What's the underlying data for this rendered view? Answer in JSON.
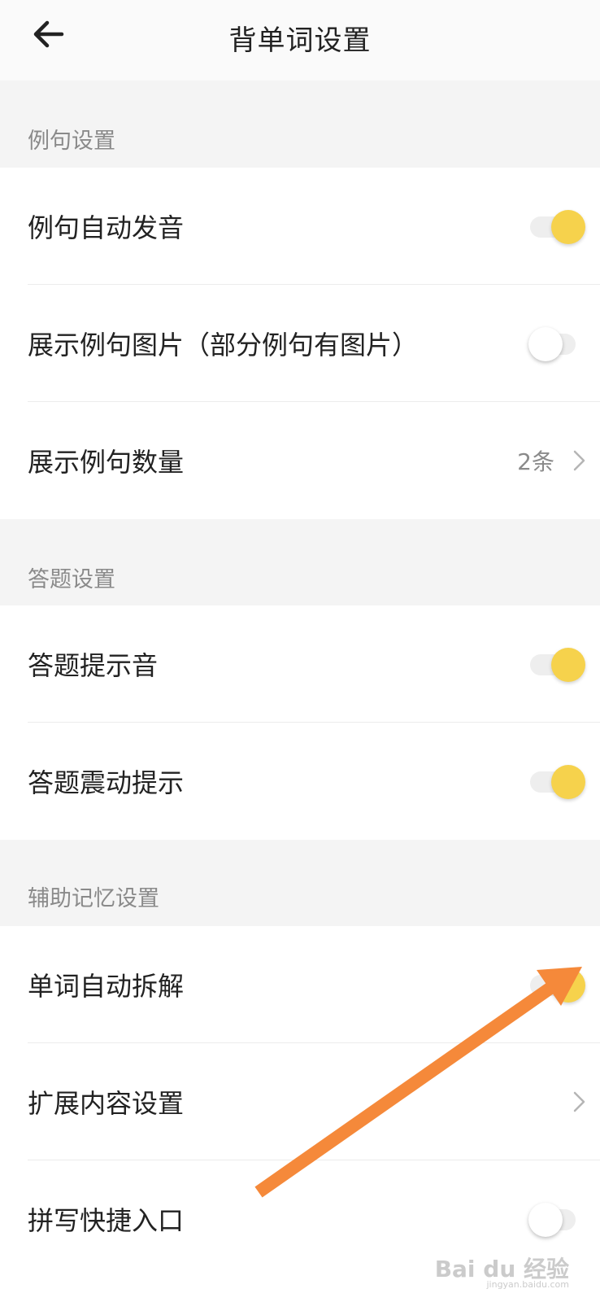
{
  "header": {
    "title": "背单词设置",
    "back_icon": "arrow-left-icon"
  },
  "sections": [
    {
      "title": "例句设置",
      "rows": [
        {
          "label": "例句自动发音",
          "type": "toggle",
          "on": true
        },
        {
          "label": "展示例句图片（部分例句有图片）",
          "type": "toggle",
          "on": false
        },
        {
          "label": "展示例句数量",
          "type": "value",
          "value": "2条"
        }
      ]
    },
    {
      "title": "答题设置",
      "rows": [
        {
          "label": "答题提示音",
          "type": "toggle",
          "on": true
        },
        {
          "label": "答题震动提示",
          "type": "toggle",
          "on": true
        }
      ]
    },
    {
      "title": "辅助记忆设置",
      "rows": [
        {
          "label": "单词自动拆解",
          "type": "toggle",
          "on": true
        },
        {
          "label": "扩展内容设置",
          "type": "link"
        },
        {
          "label": "拼写快捷入口",
          "type": "toggle",
          "on": false
        }
      ]
    }
  ],
  "watermark": {
    "text": "Bai du 经验",
    "sub": "jingyan.baidu.com"
  },
  "colors": {
    "toggle_on": "#f6d24c",
    "annotation_arrow": "#f5893a"
  }
}
